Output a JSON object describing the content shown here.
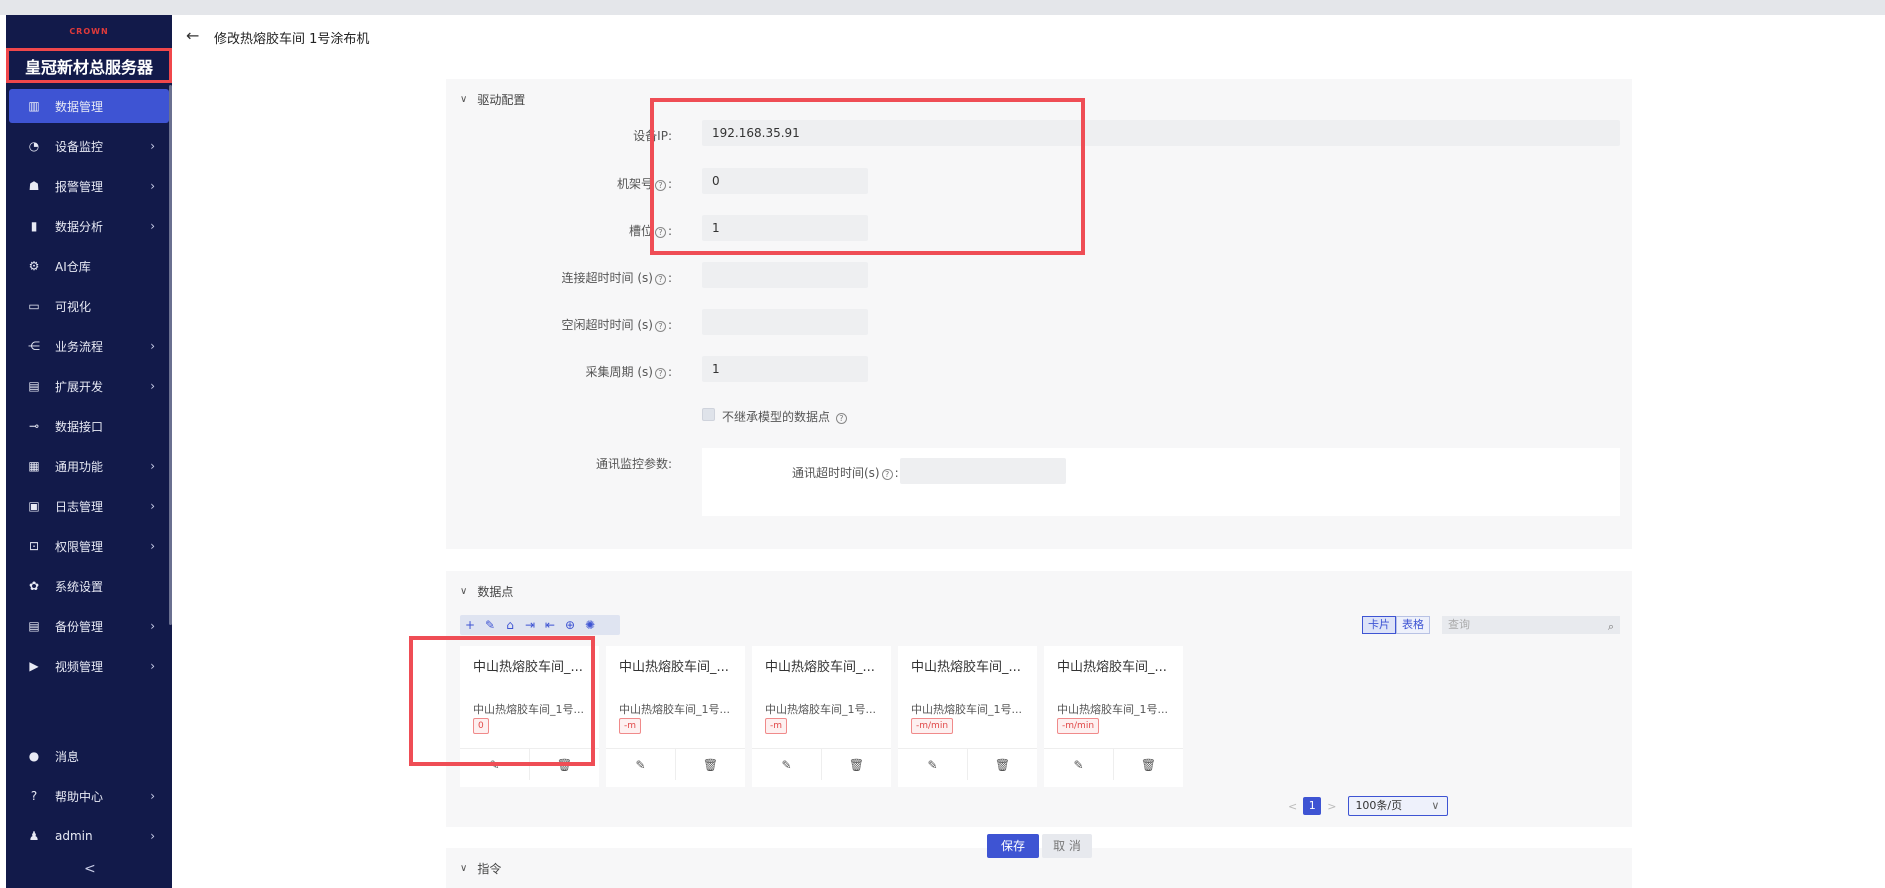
{
  "sidebar": {
    "logo": "CROWN",
    "title": "皇冠新材总服务器",
    "items": [
      {
        "label": "数据管理",
        "icon": "bar-chart-icon",
        "arrow": false,
        "active": true
      },
      {
        "label": "设备监控",
        "icon": "gauge-icon",
        "arrow": true
      },
      {
        "label": "报警管理",
        "icon": "alarm-icon",
        "arrow": true
      },
      {
        "label": "数据分析",
        "icon": "analysis-icon",
        "arrow": true
      },
      {
        "label": "AI仓库",
        "icon": "ai-icon",
        "arrow": false
      },
      {
        "label": "可视化",
        "icon": "monitor-icon",
        "arrow": false
      },
      {
        "label": "业务流程",
        "icon": "flow-icon",
        "arrow": true
      },
      {
        "label": "扩展开发",
        "icon": "extension-icon",
        "arrow": true
      },
      {
        "label": "数据接口",
        "icon": "plug-icon",
        "arrow": false
      },
      {
        "label": "通用功能",
        "icon": "grid-icon",
        "arrow": true
      },
      {
        "label": "日志管理",
        "icon": "log-icon",
        "arrow": true
      },
      {
        "label": "权限管理",
        "icon": "lock-icon",
        "arrow": true
      },
      {
        "label": "系统设置",
        "icon": "gear-icon",
        "arrow": false
      },
      {
        "label": "备份管理",
        "icon": "backup-icon",
        "arrow": true
      },
      {
        "label": "视频管理",
        "icon": "video-icon",
        "arrow": true
      }
    ],
    "bottom": [
      {
        "label": "消息",
        "icon": "message-icon",
        "arrow": false
      },
      {
        "label": "帮助中心",
        "icon": "help-icon",
        "arrow": true
      },
      {
        "label": "admin",
        "icon": "user-icon",
        "arrow": true
      }
    ],
    "collapse": "<"
  },
  "header": {
    "title": "修改热熔胶车间 1号涂布机"
  },
  "driver": {
    "section_title": "驱动配置",
    "fields": [
      {
        "label": "设备IP",
        "value": "192.168.35.91",
        "help": false
      },
      {
        "label": "机架号",
        "value": "0",
        "help": true
      },
      {
        "label": "槽位",
        "value": "1",
        "help": true
      },
      {
        "label": "连接超时时间 (s)",
        "value": "",
        "help": true
      },
      {
        "label": "空闲超时时间 (s)",
        "value": "",
        "help": true
      },
      {
        "label": "采集周期 (s)",
        "value": "1",
        "help": true
      }
    ],
    "checkbox_label": "不继承模型的数据点",
    "monitor_label": "通讯监控参数",
    "comm_timeout_label": "通讯超时时间(s)",
    "comm_timeout_value": ""
  },
  "datapoints": {
    "section_title": "数据点",
    "view_card": "卡片",
    "view_table": "表格",
    "search_placeholder": "查询",
    "cards": [
      {
        "title": "中山热熔胶车间_...",
        "sub": "中山热熔胶车间_1号...",
        "tag": "0"
      },
      {
        "title": "中山热熔胶车间_...",
        "sub": "中山热熔胶车间_1号...",
        "tag": "-m"
      },
      {
        "title": "中山热熔胶车间_...",
        "sub": "中山热熔胶车间_1号...",
        "tag": "-m"
      },
      {
        "title": "中山热熔胶车间_...",
        "sub": "中山热熔胶车间_1号...",
        "tag": "-m/min"
      },
      {
        "title": "中山热熔胶车间_...",
        "sub": "中山热熔胶车间_1号...",
        "tag": "-m/min"
      }
    ],
    "page": "1",
    "page_size": "100条/页"
  },
  "commands": {
    "section_title": "指令"
  },
  "actions": {
    "save": "保存",
    "cancel": "取 消"
  },
  "colors": {
    "sidebar": "#121a4a",
    "accent": "#3e54d3",
    "highlight": "#ef4d55"
  }
}
